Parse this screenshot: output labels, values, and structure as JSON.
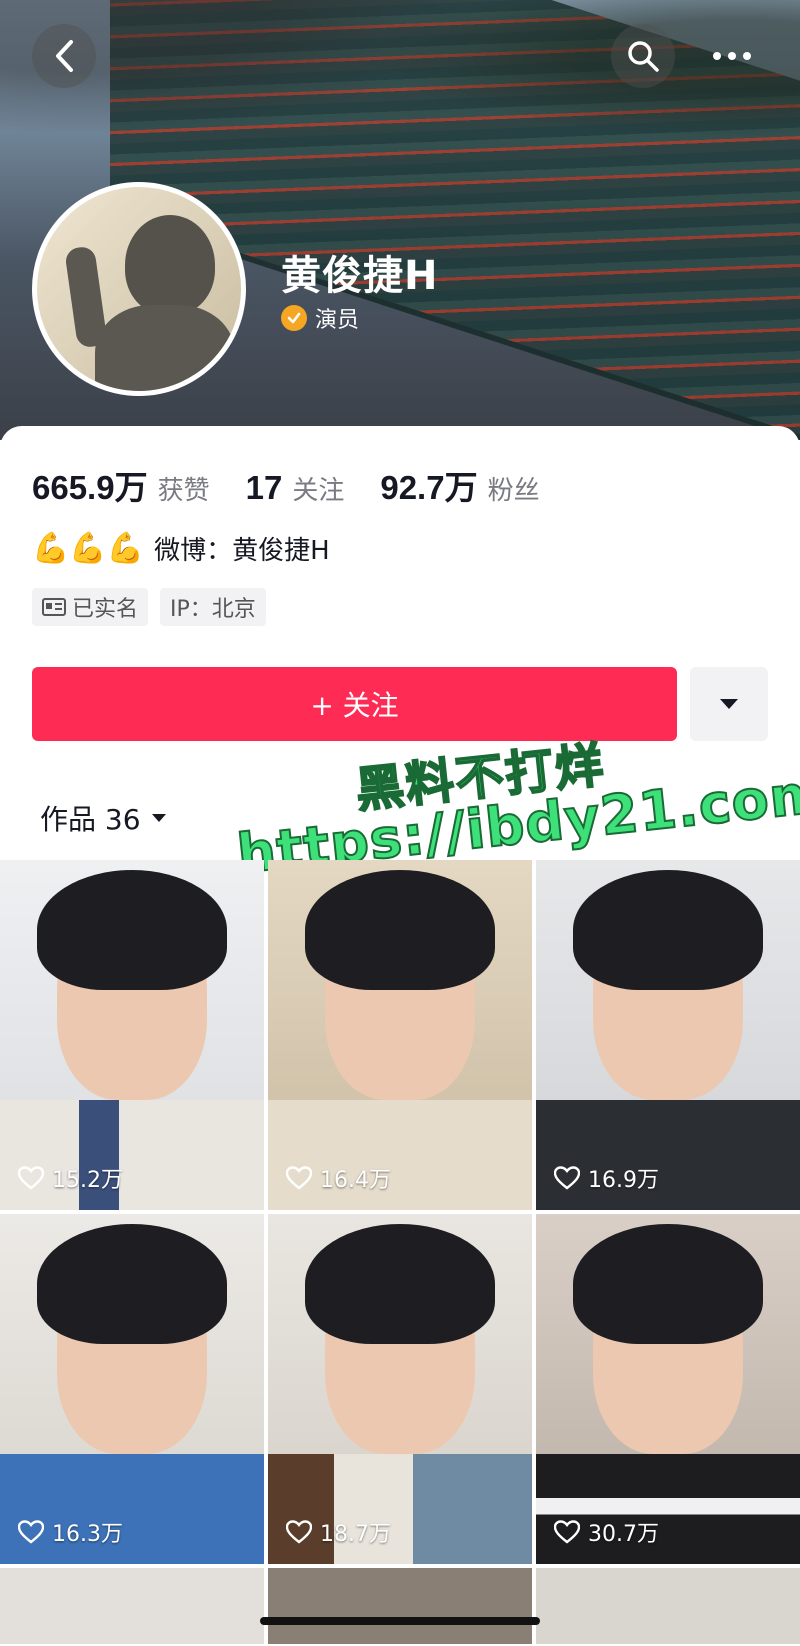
{
  "header": {
    "back_icon": "chevron-left-icon",
    "search_icon": "search-icon",
    "more_icon": "more-horizontal-icon"
  },
  "profile": {
    "name": "黄俊捷H",
    "verify_label": "演员",
    "verify_color": "#f5a623"
  },
  "stats": [
    {
      "value": "665.9万",
      "label": "获赞"
    },
    {
      "value": "17",
      "label": "关注"
    },
    {
      "value": "92.7万",
      "label": "粉丝"
    }
  ],
  "bio": {
    "emoji": "💪💪💪",
    "text": "微博：黄俊捷H"
  },
  "tags": [
    {
      "icon": "id-card-icon",
      "label": "已实名"
    },
    {
      "label": "IP：北京"
    }
  ],
  "actions": {
    "follow_label": "+ 关注",
    "follow_color": "#fe2c55",
    "dropdown_icon": "triangle-down-icon"
  },
  "tabs": {
    "works_label": "作品 36"
  },
  "watermark": {
    "line1": "黑料不打烊",
    "line2": "https://ibdy21.com"
  },
  "videos": [
    {
      "likes": "15.2万"
    },
    {
      "likes": "16.4万"
    },
    {
      "likes": "16.9万"
    },
    {
      "likes": "16.3万"
    },
    {
      "likes": "18.7万"
    },
    {
      "likes": "30.7万"
    }
  ]
}
